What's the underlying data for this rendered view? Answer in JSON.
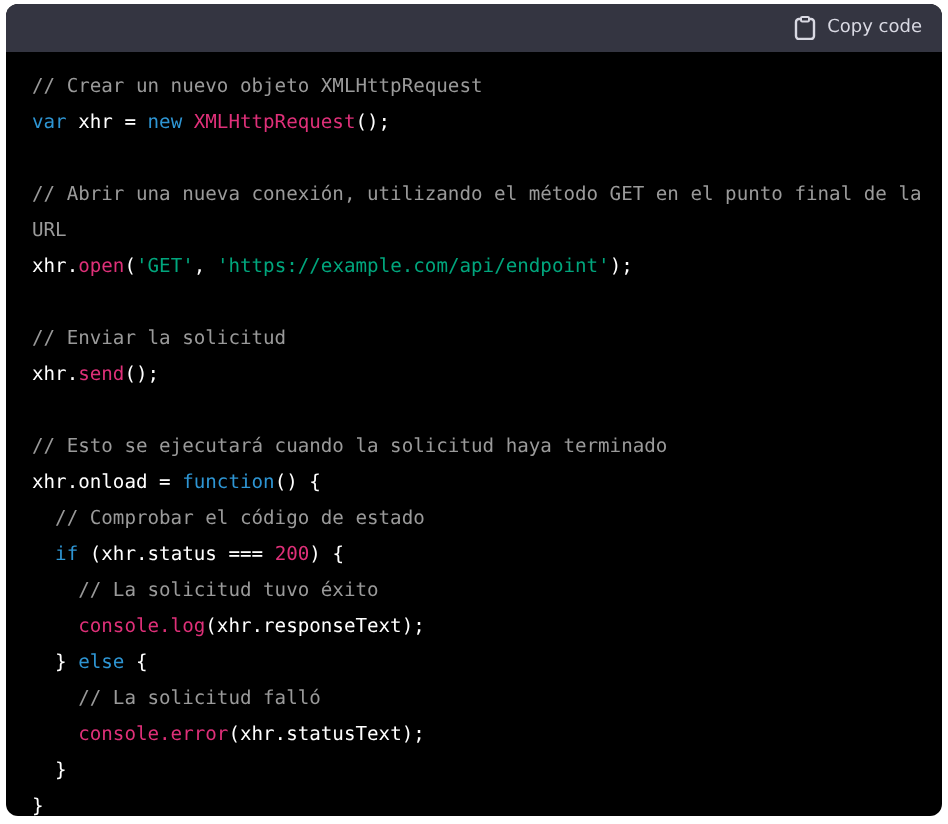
{
  "header": {
    "copy_button": {
      "label": "Copy code"
    }
  },
  "code_lines": [
    {
      "kind": "code",
      "tokens": [
        {
          "kind": "comment",
          "text": "// Crear un nuevo objeto XMLHttpRequest"
        }
      ]
    },
    {
      "kind": "code",
      "tokens": [
        {
          "kind": "keyword",
          "text": "var"
        },
        {
          "kind": "plain",
          "text": " xhr = "
        },
        {
          "kind": "keyword",
          "text": "new "
        },
        {
          "kind": "function",
          "text": "XMLHttpRequest"
        },
        {
          "kind": "plain",
          "text": "();"
        }
      ]
    },
    {
      "kind": "blank"
    },
    {
      "kind": "code",
      "tokens": [
        {
          "kind": "comment",
          "text": "// Abrir una nueva conexión, utilizando el método GET en el punto final de la"
        }
      ]
    },
    {
      "kind": "code",
      "tokens": [
        {
          "kind": "comment",
          "text": "URL"
        }
      ]
    },
    {
      "kind": "code",
      "tokens": [
        {
          "kind": "plain",
          "text": "xhr."
        },
        {
          "kind": "function",
          "text": "open"
        },
        {
          "kind": "plain",
          "text": "("
        },
        {
          "kind": "string",
          "text": "'GET'"
        },
        {
          "kind": "plain",
          "text": ", "
        },
        {
          "kind": "string",
          "text": "'https://example.com/api/endpoint'"
        },
        {
          "kind": "plain",
          "text": ");"
        }
      ]
    },
    {
      "kind": "blank"
    },
    {
      "kind": "code",
      "tokens": [
        {
          "kind": "comment",
          "text": "// Enviar la solicitud"
        }
      ]
    },
    {
      "kind": "code",
      "tokens": [
        {
          "kind": "plain",
          "text": "xhr."
        },
        {
          "kind": "function",
          "text": "send"
        },
        {
          "kind": "plain",
          "text": "();"
        }
      ]
    },
    {
      "kind": "blank"
    },
    {
      "kind": "code",
      "tokens": [
        {
          "kind": "comment",
          "text": "// Esto se ejecutará cuando la solicitud haya terminado"
        }
      ]
    },
    {
      "kind": "code",
      "tokens": [
        {
          "kind": "plain",
          "text": "xhr.onload = "
        },
        {
          "kind": "keyword",
          "text": "function"
        },
        {
          "kind": "plain",
          "text": "() {"
        }
      ]
    },
    {
      "kind": "code",
      "tokens": [
        {
          "kind": "comment",
          "text": "  // Comprobar el código de estado"
        }
      ]
    },
    {
      "kind": "code",
      "tokens": [
        {
          "kind": "keyword",
          "text": "  if"
        },
        {
          "kind": "plain",
          "text": " (xhr.status === "
        },
        {
          "kind": "number",
          "text": "200"
        },
        {
          "kind": "plain",
          "text": ") {"
        }
      ]
    },
    {
      "kind": "code",
      "tokens": [
        {
          "kind": "comment",
          "text": "    // La solicitud tuvo éxito"
        }
      ]
    },
    {
      "kind": "code",
      "tokens": [
        {
          "kind": "function",
          "text": "    console.log"
        },
        {
          "kind": "plain",
          "text": "(xhr.responseText);"
        }
      ]
    },
    {
      "kind": "code",
      "tokens": [
        {
          "kind": "plain",
          "text": "  } "
        },
        {
          "kind": "keyword",
          "text": "else"
        },
        {
          "kind": "plain",
          "text": " {"
        }
      ]
    },
    {
      "kind": "code",
      "tokens": [
        {
          "kind": "comment",
          "text": "    // La solicitud falló"
        }
      ]
    },
    {
      "kind": "code",
      "tokens": [
        {
          "kind": "function",
          "text": "    console.error"
        },
        {
          "kind": "plain",
          "text": "(xhr.statusText);"
        }
      ]
    },
    {
      "kind": "code",
      "tokens": [
        {
          "kind": "plain",
          "text": "  }"
        }
      ]
    },
    {
      "kind": "code",
      "tokens": [
        {
          "kind": "plain",
          "text": "}"
        }
      ]
    }
  ]
}
